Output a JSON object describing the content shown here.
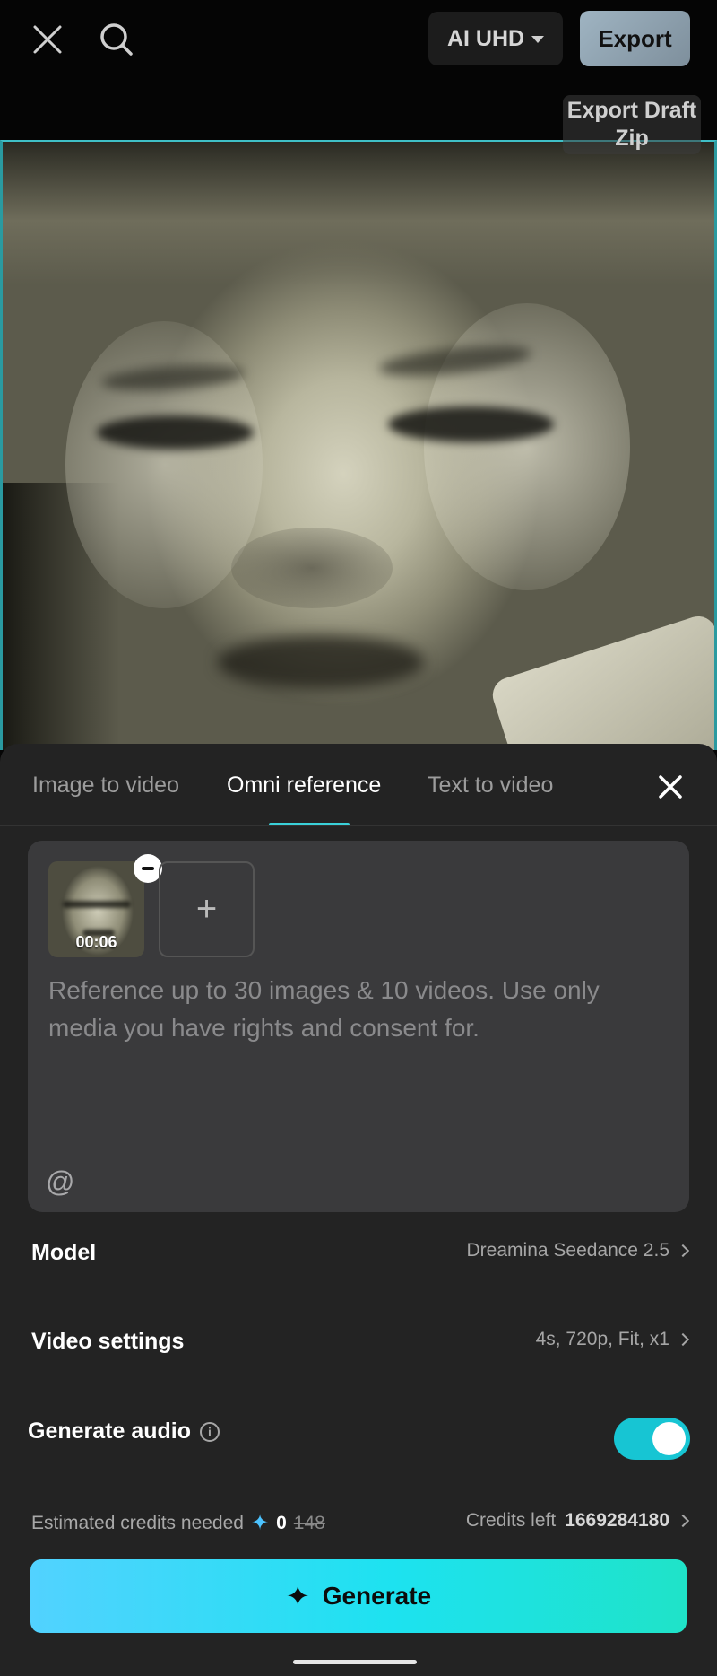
{
  "topbar": {
    "quality_label": "AI UHD",
    "export_label": "Export",
    "draft_zip_label": "Export Draft Zip"
  },
  "tabs": [
    {
      "label": "Image to video",
      "active": false
    },
    {
      "label": "Omni reference",
      "active": true
    },
    {
      "label": "Text to video",
      "active": false
    }
  ],
  "reference": {
    "thumb_duration": "00:06",
    "add_label": "+",
    "placeholder": "Reference up to 30 images & 10 videos. Use only media you have rights and consent for.",
    "mention_symbol": "@"
  },
  "model": {
    "label": "Model",
    "value": "Dreamina Seedance 2.5"
  },
  "video_settings": {
    "label": "Video settings",
    "value": "4s, 720p, Fit, x1"
  },
  "generate_audio": {
    "label": "Generate audio",
    "info_glyph": "i",
    "enabled": true
  },
  "credits": {
    "needed_label": "Estimated credits needed",
    "spark_glyph": "✦",
    "needed_value": "0",
    "needed_original": "148",
    "left_label": "Credits left",
    "left_value": "1669284180"
  },
  "generate": {
    "label": "Generate",
    "icon_glyph": "✦"
  },
  "colors": {
    "accent": "#3ad1d9",
    "toggle_on": "#17c5d3",
    "generate_start": "#52d2ff",
    "generate_end": "#1fe3c8",
    "sheet_bg": "#232323"
  }
}
